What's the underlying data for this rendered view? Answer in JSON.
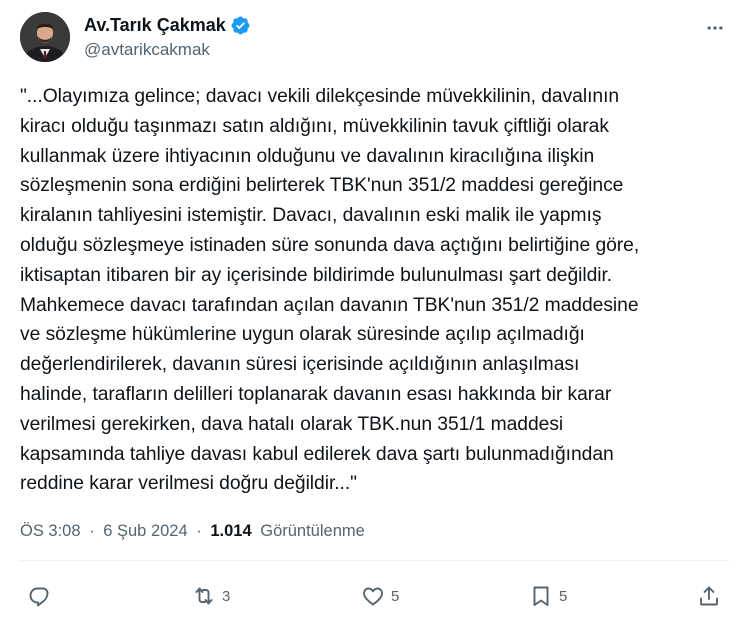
{
  "author": {
    "display_name": "Av.Tarık Çakmak",
    "handle": "@avtarikcakmak",
    "verified": true
  },
  "tweet": {
    "text": "\"...Olayımıza gelince; davacı vekili dilekçesinde müvekkilinin, davalının\nkiracı olduğu taşınmazı satın aldığını, müvekkilinin tavuk çiftliği olarak\nkullanmak üzere ihtiyacının olduğunu ve davalının kiracılığına ilişkin\nsözleşmenin sona erdiğini belirterek TBK'nun 351/2 maddesi gereğince\nkiralanın tahliyesini istemiştir. Davacı, davalının eski malik ile yapmış\nolduğu sözleşmeye istinaden süre sonunda dava açtığını belirtiğine göre,\niktisaptan itibaren bir ay içerisinde bildirimde bulunulması şart değildir.\nMahkemece davacı tarafından açılan davanın TBK'nun 351/2 maddesine\nve sözleşme hükümlerine uygun olarak süresinde açılıp açılmadığı\ndeğerlendirilerek, davanın süresi içerisinde açıldığının anlaşılması\nhalinde, tarafların delilleri toplanarak davanın esası hakkında bir karar\nverilmesi gerekirken, dava hatalı olarak TBK.nun 351/1 maddesi\nkapsamında tahliye davası kabul edilerek dava şartı bulunmadığından\nreddine karar verilmesi doğru değildir...\"",
    "time": "ÖS 3:08",
    "dot": "·",
    "date": "6 Şub 2024",
    "views_count": "1.014",
    "views_label": "Görüntülenme"
  },
  "actions": {
    "reply": {
      "icon": "reply-icon",
      "count": ""
    },
    "retweet": {
      "icon": "retweet-icon",
      "count": "3"
    },
    "like": {
      "icon": "heart-icon",
      "count": "5"
    },
    "bookmark": {
      "icon": "bookmark-icon",
      "count": "5"
    },
    "share": {
      "icon": "share-icon",
      "count": ""
    }
  },
  "colors": {
    "text": "#0f1419",
    "secondary": "#536471",
    "verified": "#1d9bf0",
    "divider": "#eff3f4"
  }
}
